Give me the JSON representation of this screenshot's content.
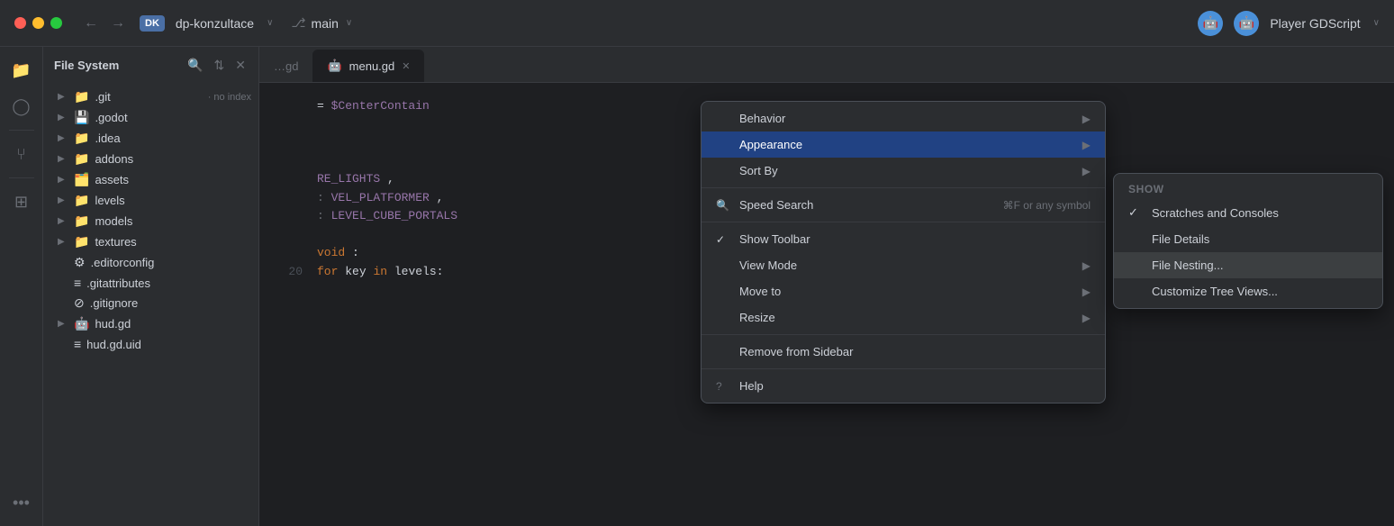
{
  "titlebar": {
    "repo_badge": "DK",
    "repo_name": "dp-konzultace",
    "branch_icon": "⎇",
    "branch_name": "main",
    "player_label": "Player GDScript",
    "bot_icon": "🤖"
  },
  "nav": {
    "back": "←",
    "forward": "→",
    "dropdown": "∨"
  },
  "sidebar": {
    "title": "File System",
    "items": [
      {
        "type": "folder",
        "name": ".git",
        "badge": "no index",
        "indent": 0
      },
      {
        "type": "folder",
        "name": ".godot",
        "badge": "",
        "indent": 0
      },
      {
        "type": "folder",
        "name": ".idea",
        "badge": "",
        "indent": 0
      },
      {
        "type": "folder",
        "name": "addons",
        "badge": "",
        "indent": 0
      },
      {
        "type": "folder",
        "name": "assets",
        "badge": "",
        "indent": 0
      },
      {
        "type": "folder",
        "name": "levels",
        "badge": "",
        "indent": 0
      },
      {
        "type": "folder",
        "name": "models",
        "badge": "",
        "indent": 0
      },
      {
        "type": "folder",
        "name": "textures",
        "badge": "",
        "indent": 0
      },
      {
        "type": "file",
        "name": ".editorconfig",
        "badge": "",
        "indent": 0
      },
      {
        "type": "file",
        "name": ".gitattributes",
        "badge": "",
        "indent": 0
      },
      {
        "type": "file",
        "name": ".gitignore",
        "badge": "",
        "indent": 0
      },
      {
        "type": "gdscript",
        "name": "hud.gd",
        "badge": "",
        "indent": 0
      },
      {
        "type": "file",
        "name": "hud.gd.uid",
        "badge": "",
        "indent": 0
      }
    ]
  },
  "tabs": [
    {
      "name": "…gd",
      "active": false,
      "closable": false
    },
    {
      "name": "menu.gd",
      "active": true,
      "closable": true
    }
  ],
  "code_lines": [
    {
      "num": "20",
      "content": "for key in levels:"
    }
  ],
  "context_menu": {
    "items": [
      {
        "id": "behavior",
        "label": "Behavior",
        "has_submenu": true,
        "icon": "",
        "checkmark": ""
      },
      {
        "id": "appearance",
        "label": "Appearance",
        "has_submenu": true,
        "icon": "",
        "checkmark": "",
        "highlighted": true
      },
      {
        "id": "sort_by",
        "label": "Sort By",
        "has_submenu": true,
        "icon": "",
        "checkmark": ""
      },
      {
        "separator": true
      },
      {
        "id": "speed_search",
        "label": "Speed Search",
        "shortcut": "⌘F or any symbol",
        "icon": "search",
        "checkmark": ""
      },
      {
        "separator": true
      },
      {
        "id": "show_toolbar",
        "label": "Show Toolbar",
        "checkmark": "✓",
        "icon": ""
      },
      {
        "id": "view_mode",
        "label": "View Mode",
        "has_submenu": true,
        "icon": "",
        "checkmark": ""
      },
      {
        "id": "move_to",
        "label": "Move to",
        "has_submenu": true,
        "icon": "",
        "checkmark": ""
      },
      {
        "id": "resize",
        "label": "Resize",
        "has_submenu": true,
        "icon": "",
        "checkmark": ""
      },
      {
        "separator": true
      },
      {
        "id": "remove_sidebar",
        "label": "Remove from Sidebar",
        "icon": "",
        "checkmark": ""
      },
      {
        "separator": true
      },
      {
        "id": "help",
        "label": "Help",
        "icon": "?",
        "checkmark": ""
      }
    ]
  },
  "submenu": {
    "header": "Show",
    "items": [
      {
        "id": "scratches",
        "label": "Scratches and Consoles",
        "checked": true
      },
      {
        "id": "file_details",
        "label": "File Details",
        "checked": false
      },
      {
        "id": "file_nesting",
        "label": "File Nesting...",
        "checked": false,
        "highlighted": true
      },
      {
        "id": "customize_tree",
        "label": "Customize Tree Views...",
        "checked": false
      }
    ]
  },
  "code": {
    "prefix": "= $CenterContain",
    "const1": "RE_LIGHTS",
    "const2": "VEL_PLATFORMER",
    "const3": "LEVEL_CUBE_PORTALS",
    "for_line_num": "20",
    "for_line": "for key in levels:",
    "fn_label": "void:"
  }
}
